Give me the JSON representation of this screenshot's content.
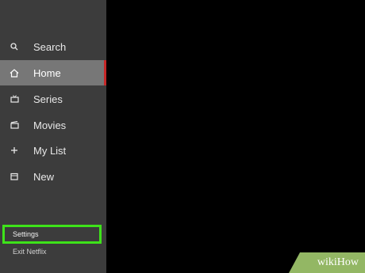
{
  "sidebar": {
    "items": [
      {
        "label": "Search",
        "icon": "search-icon"
      },
      {
        "label": "Home",
        "icon": "home-icon",
        "active": true
      },
      {
        "label": "Series",
        "icon": "tv-icon"
      },
      {
        "label": "Movies",
        "icon": "film-icon"
      },
      {
        "label": "My List",
        "icon": "plus-icon"
      },
      {
        "label": "New",
        "icon": "calendar-icon"
      }
    ],
    "settings": "Settings",
    "exit": "Exit Netflix"
  },
  "colors": {
    "sidebar_bg": "#3c3c3c",
    "active_bg": "#777777",
    "active_indicator": "#c62828",
    "highlight": "#3ee31a"
  },
  "watermark": {
    "text": "wikiHow"
  }
}
